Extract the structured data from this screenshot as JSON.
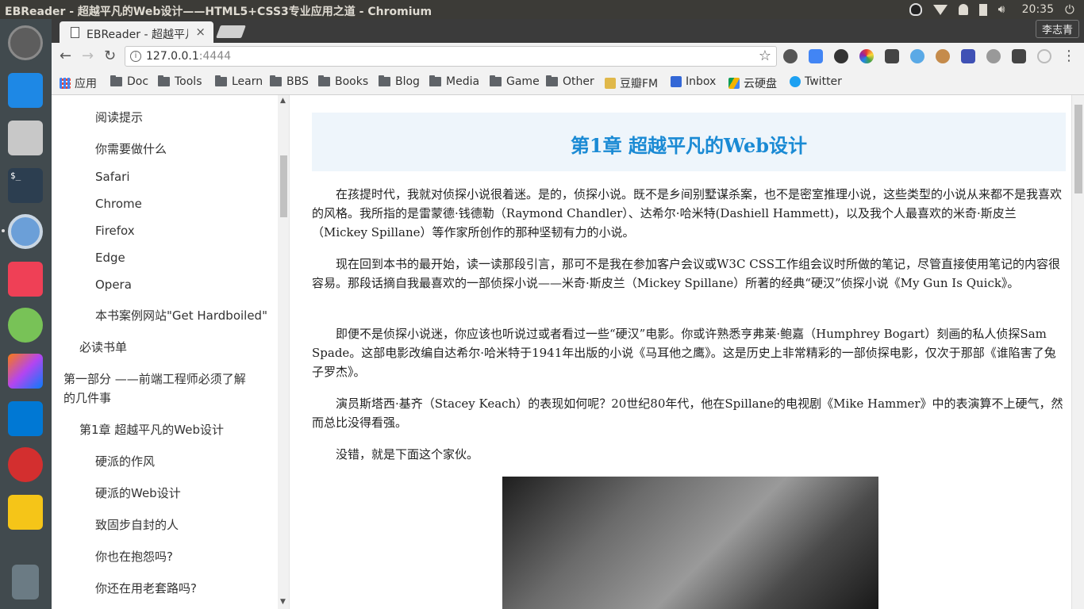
{
  "window": {
    "title": "EBReader - 超越平凡的Web设计——HTML5+CSS3专业应用之道 - Chromium"
  },
  "system": {
    "clock": "20:35",
    "user": "李志青"
  },
  "browser": {
    "tab_title": "EBReader - 超越平凡的Web设计",
    "tab_close": "×",
    "url_host": "127.0.0.1",
    "url_port": ":4444",
    "bookmarks": [
      "应用",
      "Doc",
      "Tools",
      "Learn",
      "BBS",
      "Books",
      "Blog",
      "Media",
      "Game",
      "Other",
      "豆瓣FM",
      "Inbox",
      "云硬盘",
      "Twitter"
    ]
  },
  "toc": [
    "阅读提示",
    "你需要做什么",
    "Safari",
    "Chrome",
    "Firefox",
    "Edge",
    "Opera",
    "本书案例网站\"Get Hardboiled\"",
    "必读书单",
    "第一部分 ——前端工程师必须了解",
    "的几件事",
    "第1章 超越平凡的Web设计",
    "硬派的作风",
    "硬派的Web设计",
    "致固步自封的人",
    "你也在抱怨吗?",
    "你还在用老套路吗?"
  ],
  "content": {
    "chapter_title": "第1章 超越平凡的Web设计",
    "paragraphs": [
      "在孩提时代，我就对侦探小说很着迷。是的，侦探小说。既不是乡间别墅谋杀案，也不是密室推理小说，这些类型的小说从来都不是我喜欢的风格。我所指的是雷蒙德·钱德勒（Raymond Chandler）、达希尔·哈米特(Dashiell Hammett)，以及我个人最喜欢的米奇·斯皮兰（Mickey Spillane）等作家所创作的那种坚韧有力的小说。",
      "现在回到本书的最开始，读一读那段引言，那可不是我在参加客户会议或W3C CSS工作组会议时所做的笔记，尽管直接使用笔记的内容很容易。那段话摘自我最喜欢的一部侦探小说——米奇·斯皮兰（Mickey Spillane）所著的经典“硬汉”侦探小说《My Gun Is Quick》。",
      "即便不是侦探小说迷，你应该也听说过或者看过一些“硬汉”电影。你或许熟悉亨弗莱·鲍嘉（Humphrey Bogart）刻画的私人侦探Sam Spade。这部电影改编自达希尔·哈米特于1941年出版的小说《马耳他之鹰》。这是历史上非常精彩的一部侦探电影，仅次于那部《谁陷害了兔子罗杰》。",
      "演员斯塔西·基齐（Stacey Keach）的表现如何呢？20世纪80年代，他在Spillane的电视剧《Mike Hammer》中的表演算不上硬气，然而总比没得看强。",
      "没错，就是下面这个家伙。"
    ]
  },
  "colors": {
    "accent": "#1a8ad4",
    "chapter_bg": "#eef5fb",
    "launcher_bg": "#414a4e",
    "topbar_bg": "#3c3b37"
  }
}
